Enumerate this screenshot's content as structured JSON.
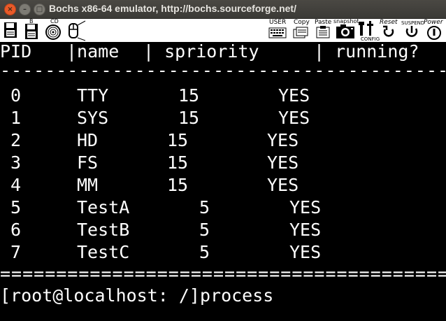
{
  "window": {
    "title": "Bochs x86-64 emulator, http://bochs.sourceforge.net/"
  },
  "toolbar": {
    "buttons": [
      {
        "id": "floppy-a",
        "label": ""
      },
      {
        "id": "floppy-b",
        "label": "B"
      },
      {
        "id": "cdrom",
        "label": "CD"
      },
      {
        "id": "mouse",
        "label": ""
      },
      {
        "id": "user",
        "label": "USER"
      },
      {
        "id": "copy",
        "label": "Copy"
      },
      {
        "id": "paste",
        "label": "Paste"
      },
      {
        "id": "snapshot",
        "label": "snapshot"
      },
      {
        "id": "config",
        "label": "CONFIG"
      },
      {
        "id": "reset",
        "label": "Reset"
      },
      {
        "id": "suspend",
        "label": "SUSPEND"
      },
      {
        "id": "power",
        "label": "Power"
      }
    ]
  },
  "terminal": {
    "header": {
      "col1": "PID",
      "col2": "|name",
      "col3": "| spriority",
      "col4": "| running?"
    },
    "dash_rule": "----------------------------------------",
    "rows": [
      {
        "pid": "0",
        "name": "TTY",
        "priority": "15",
        "running": "YES"
      },
      {
        "pid": "1",
        "name": "SYS",
        "priority": "15",
        "running": "YES"
      },
      {
        "pid": "2",
        "name": "HD",
        "priority": "15",
        "running": "YES"
      },
      {
        "pid": "3",
        "name": "FS",
        "priority": "15",
        "running": "YES"
      },
      {
        "pid": "4",
        "name": "MM",
        "priority": "15",
        "running": "YES"
      },
      {
        "pid": "5",
        "name": "TestA",
        "priority": "5",
        "running": "YES"
      },
      {
        "pid": "6",
        "name": "TestB",
        "priority": "5",
        "running": "YES"
      },
      {
        "pid": "7",
        "name": "TestC",
        "priority": "5",
        "running": "YES"
      }
    ],
    "equals_rule": "========================================",
    "prompt": "[root@localhost: /]process"
  }
}
